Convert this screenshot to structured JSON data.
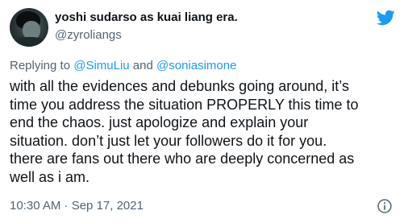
{
  "author": {
    "display_name": "yoshi sudarso as kuai liang era.",
    "handle": "@zyroliangs",
    "avatar_icon": "profile-photo"
  },
  "brand": {
    "icon": "twitter-bird-icon",
    "color": "#1d9bf0"
  },
  "reply": {
    "prefix": "Replying to ",
    "mention_1": "@SimuLiu",
    "connector": " and ",
    "mention_2": "@soniasimone"
  },
  "tweet": {
    "lines": [
      "with all the evidences and debunks going around, it’s",
      "time you address the situation PROPERLY this time to",
      "end the chaos. just apologize and explain your",
      "situation. don’t just let your followers do it for you.",
      "there are fans out there who are deeply concerned as",
      "well as i am."
    ]
  },
  "meta": {
    "timestamp": "10:30 AM · Sep 17, 2021",
    "info_icon": "info-icon"
  },
  "colors": {
    "text": "#0f1419",
    "secondary": "#536471",
    "link": "#1d9bf0"
  }
}
